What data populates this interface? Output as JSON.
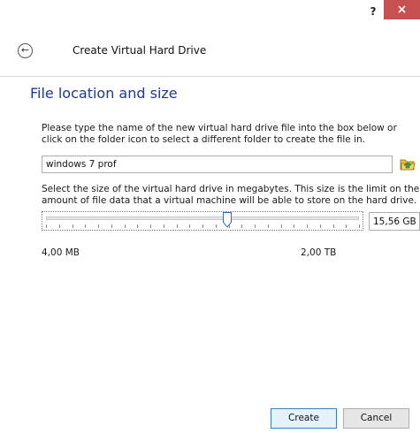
{
  "window": {
    "help_label": "?",
    "close_label": "×"
  },
  "header": {
    "back_icon": "←",
    "title": "Create Virtual Hard Drive"
  },
  "section": {
    "title": "File location and size",
    "instructions": "Please type the name of the new virtual hard drive file into the box below or click on the folder icon to select a different folder to create the file in.",
    "file_name": "windows 7 prof",
    "folder_icon": "folder-icon",
    "size_description": "Select the size of the virtual hard drive in megabytes. This size is the limit on the amount of file data that a virtual machine will be able to store on the hard drive.",
    "slider_fraction": 0.58,
    "slider_tick_count": 24,
    "size_value": "15,56 GB",
    "range_min": "4,00 MB",
    "range_max": "2,00 TB"
  },
  "footer": {
    "create_label": "Create",
    "cancel_label": "Cancel"
  },
  "colors": {
    "accent": "#1e3a8f",
    "close_red": "#c75050"
  }
}
